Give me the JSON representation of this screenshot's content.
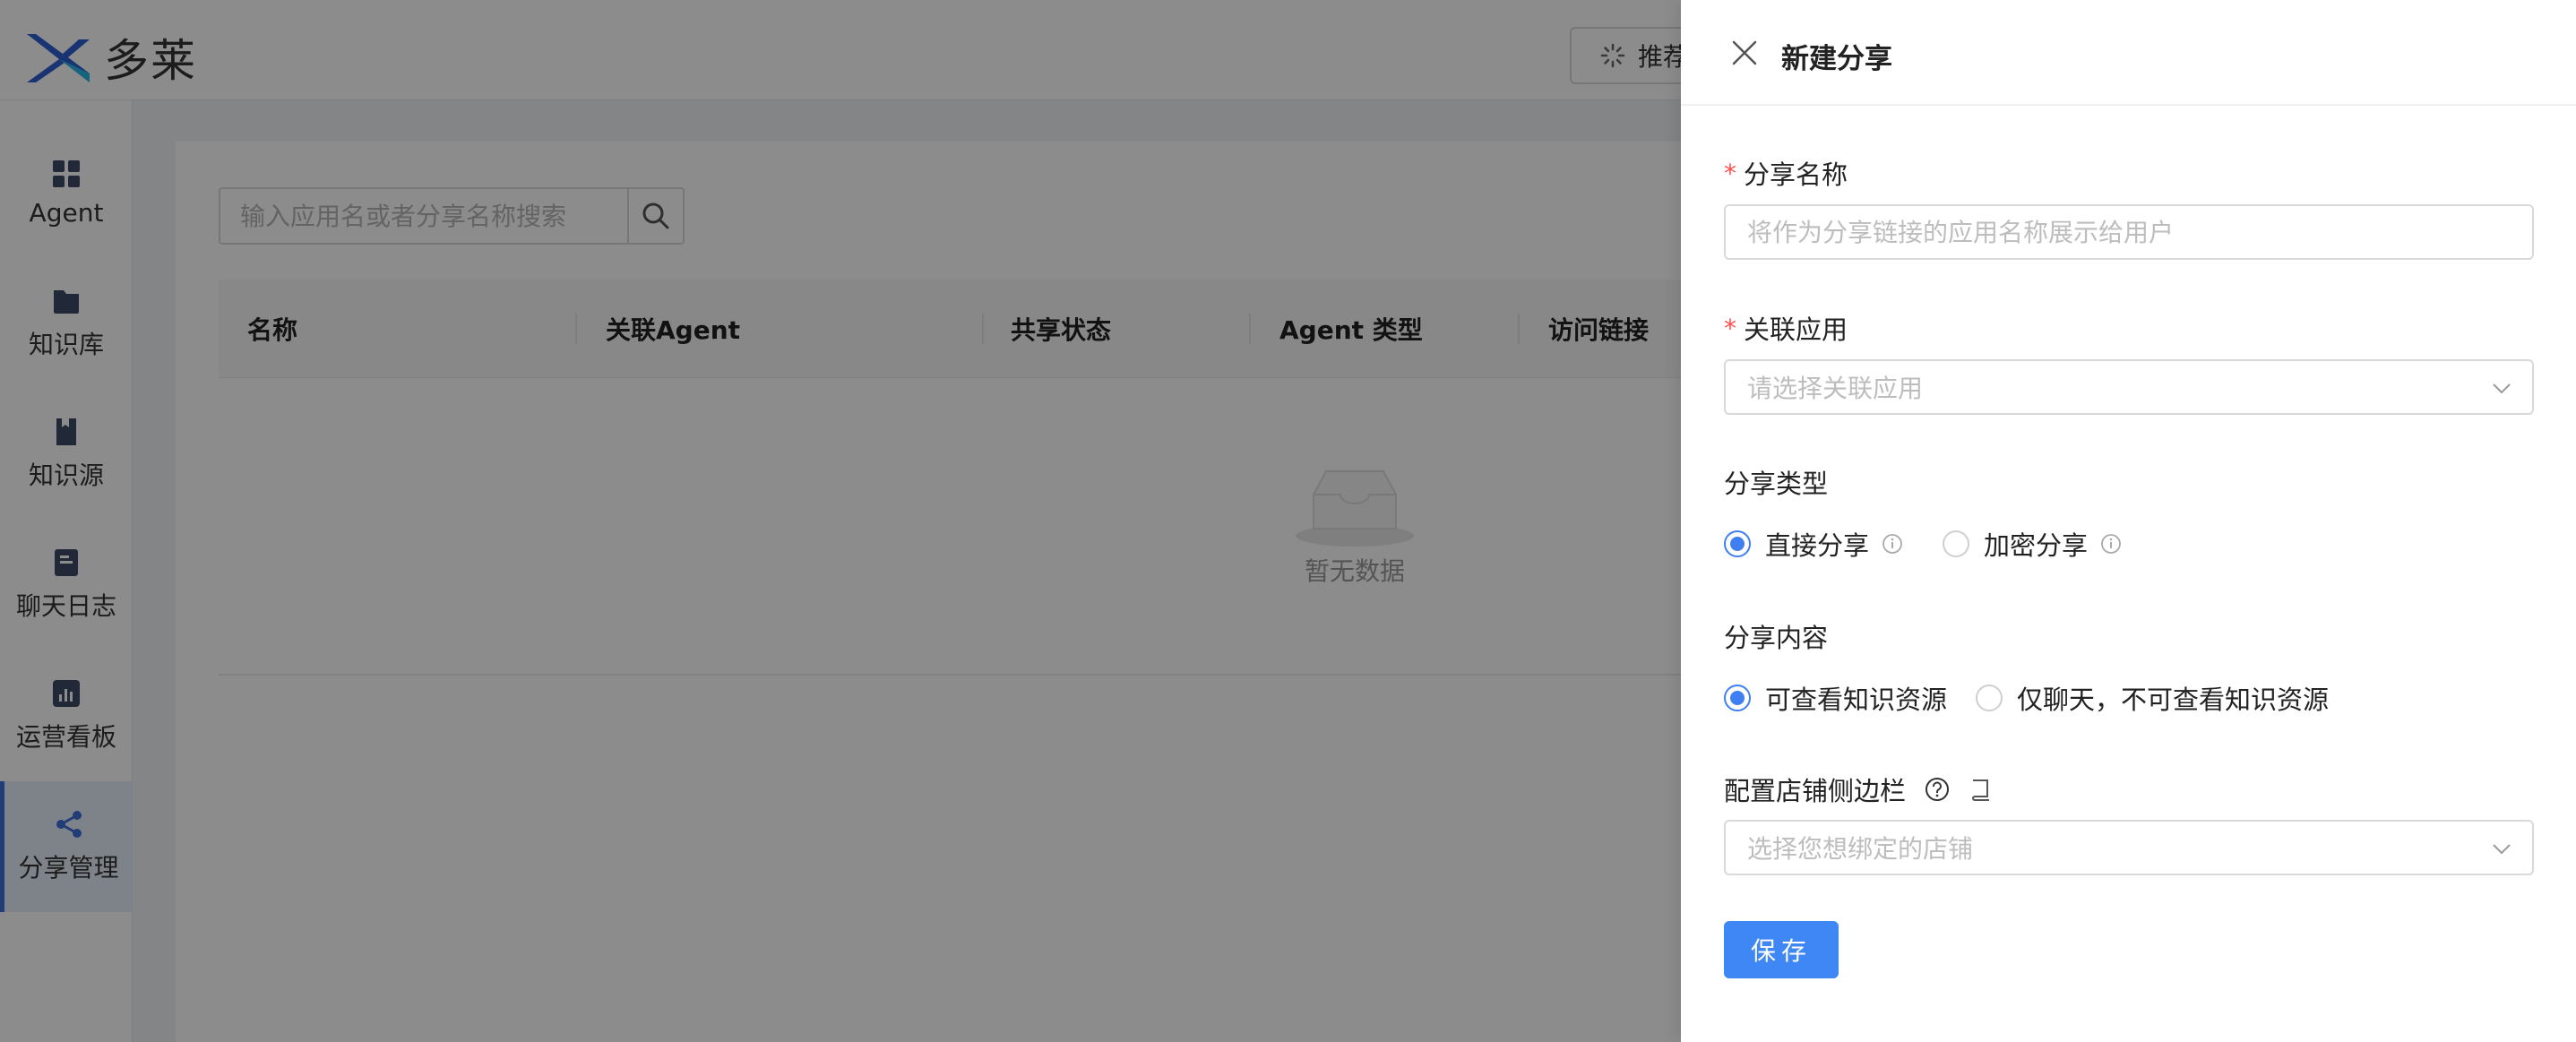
{
  "app": {
    "brand_name": "多莱",
    "recommend_label": "推荐"
  },
  "sidebar": {
    "items": [
      {
        "label": "Agent",
        "icon": "grid-icon"
      },
      {
        "label": "知识库",
        "icon": "folder-icon"
      },
      {
        "label": "知识源",
        "icon": "bookmark-book-icon"
      },
      {
        "label": "聊天日志",
        "icon": "log-icon"
      },
      {
        "label": "运营看板",
        "icon": "chart-icon"
      },
      {
        "label": "分享管理",
        "icon": "share-icon",
        "active": true
      }
    ]
  },
  "main": {
    "search_placeholder": "输入应用名或者分享名称搜索",
    "columns": [
      "名称",
      "关联Agent",
      "共享状态",
      "Agent 类型",
      "访问链接"
    ],
    "empty_text": "暂无数据"
  },
  "drawer": {
    "title": "新建分享",
    "share_name": {
      "label": "分享名称",
      "required": "*",
      "placeholder": "将作为分享链接的应用名称展示给用户",
      "value": ""
    },
    "linked_app": {
      "label": "关联应用",
      "required": "*",
      "placeholder": "请选择关联应用"
    },
    "share_type": {
      "label": "分享类型",
      "options": [
        {
          "label": "直接分享",
          "checked": true
        },
        {
          "label": "加密分享",
          "checked": false
        }
      ]
    },
    "share_content": {
      "label": "分享内容",
      "options": [
        {
          "label": "可查看知识资源",
          "checked": true
        },
        {
          "label": "仅聊天，不可查看知识资源",
          "checked": false
        }
      ]
    },
    "store_sidebar": {
      "label": "配置店铺侧边栏",
      "placeholder": "选择您想绑定的店铺"
    },
    "save_label": "保存"
  },
  "colors": {
    "primary": "#3f87f5",
    "required": "#ff4d4f",
    "active_nav_bg": "#e6eefc"
  }
}
